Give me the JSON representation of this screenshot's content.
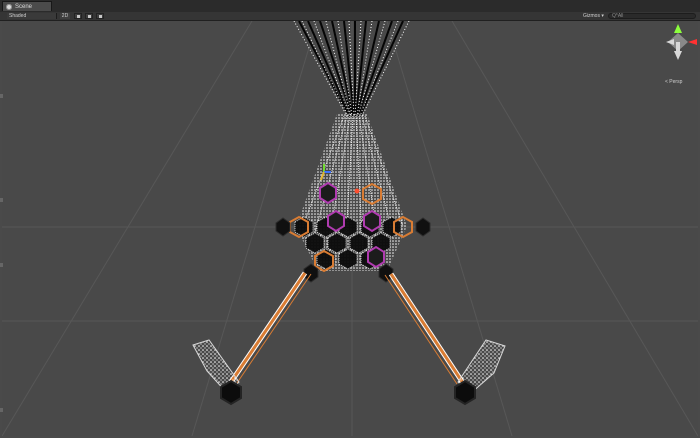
{
  "window": {
    "tab_label": "Scene"
  },
  "toolbar": {
    "shading_mode": "Shaded",
    "mode_2d": "2D",
    "gizmos_label": "Gizmos ▾",
    "search_placeholder": "Q*All"
  },
  "scene_gizmo": {
    "projection_label": "< Persp"
  },
  "colors": {
    "background": "#494949",
    "grid": "#5a5a5a",
    "particles": "#ffffff",
    "orange": "#d97c33",
    "purple": "#b03bb0",
    "dark": "#1a1a1a"
  },
  "icons": {
    "tab": "scene-icon",
    "lighting": "sun-icon",
    "audio": "speaker-icon",
    "effects": "image-icon",
    "gizmo": "scene-orientation-gizmo-icon"
  }
}
